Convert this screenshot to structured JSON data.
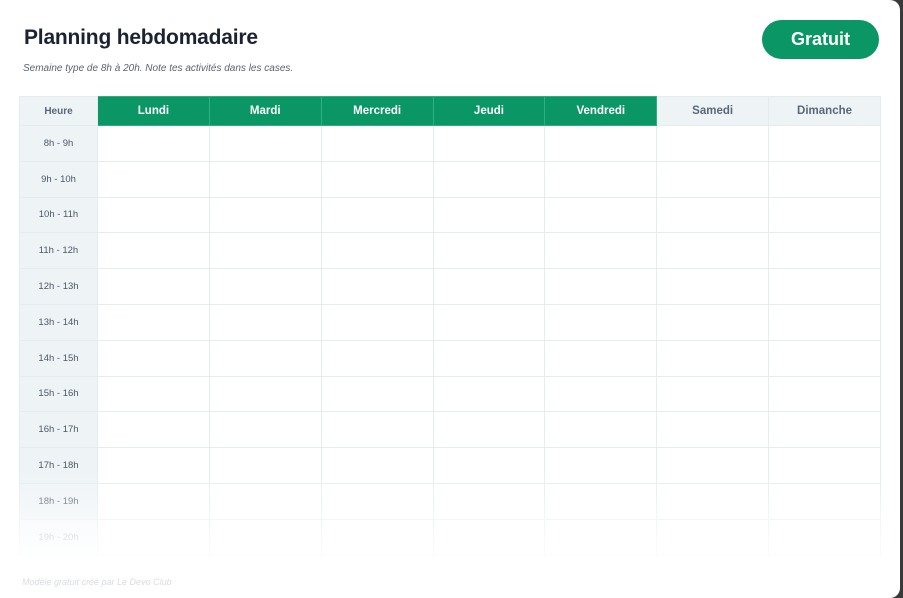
{
  "header": {
    "title": "Planning hebdomadaire",
    "subtitle": "Semaine type de 8h à 20h. Note tes activités dans les cases.",
    "badge": "Gratuit"
  },
  "table": {
    "hour_header": "Heure",
    "days": [
      "Lundi",
      "Mardi",
      "Mercredi",
      "Jeudi",
      "Vendredi",
      "Samedi",
      "Dimanche"
    ],
    "hours": [
      "8h - 9h",
      "9h - 10h",
      "10h - 11h",
      "11h - 12h",
      "12h - 13h",
      "13h - 14h",
      "14h - 15h",
      "15h - 16h",
      "16h - 17h",
      "17h - 18h",
      "18h - 19h",
      "19h - 20h"
    ]
  },
  "footer": {
    "text": "Modèle gratuit créé par Le Devo Club"
  },
  "colors": {
    "accent": "#0b9665",
    "weekend_header": "#eef3f6",
    "title": "#1b2233"
  }
}
